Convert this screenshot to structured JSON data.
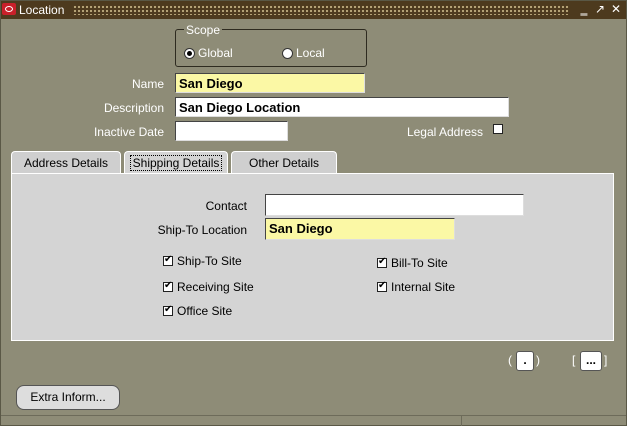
{
  "window": {
    "title": "Location"
  },
  "scope": {
    "legend": "Scope",
    "options": [
      {
        "label": "Global",
        "selected": true
      },
      {
        "label": "Local",
        "selected": false
      }
    ]
  },
  "form": {
    "name_label": "Name",
    "name_value": "San Diego",
    "description_label": "Description",
    "description_value": "San Diego Location",
    "inactive_date_label": "Inactive Date",
    "inactive_date_value": "",
    "legal_address_label": "Legal Address",
    "legal_address_checked": false
  },
  "tabs": [
    {
      "label": "Address Details",
      "active": false
    },
    {
      "label": "Shipping Details",
      "active": true
    },
    {
      "label": "Other Details",
      "active": false
    }
  ],
  "shipping": {
    "contact_label": "Contact",
    "contact_value": "",
    "ship_to_location_label": "Ship-To Location",
    "ship_to_location_value": "San Diego",
    "checkboxes": [
      {
        "label": "Ship-To Site",
        "checked": true
      },
      {
        "label": "Bill-To Site",
        "checked": true
      },
      {
        "label": "Receiving Site",
        "checked": true
      },
      {
        "label": "Internal Site",
        "checked": true
      },
      {
        "label": "Office Site",
        "checked": true
      }
    ]
  },
  "buttons": {
    "single_value_btn": ".",
    "multi_value_btn": "...",
    "extra_info": "Extra Inform..."
  },
  "colors": {
    "background": "#8e8c77",
    "titlebar": "#4d3a1e",
    "required_field": "#fbf8a5"
  }
}
